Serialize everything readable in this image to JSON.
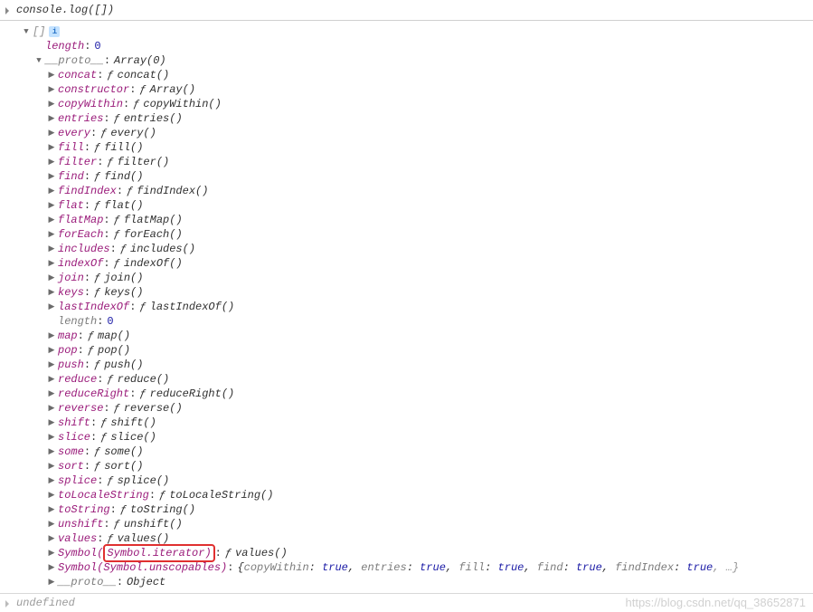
{
  "top": {
    "code": "console.log([])"
  },
  "root": {
    "tag_open": "[]",
    "info_glyph": "i",
    "length_key": "length",
    "length_val": "0",
    "proto_key": "__proto__",
    "proto_val": "Array(0)",
    "methods": [
      {
        "k": "concat",
        "v": "concat()"
      },
      {
        "k": "constructor",
        "v": "Array()"
      },
      {
        "k": "copyWithin",
        "v": "copyWithin()"
      },
      {
        "k": "entries",
        "v": "entries()"
      },
      {
        "k": "every",
        "v": "every()"
      },
      {
        "k": "fill",
        "v": "fill()"
      },
      {
        "k": "filter",
        "v": "filter()"
      },
      {
        "k": "find",
        "v": "find()"
      },
      {
        "k": "findIndex",
        "v": "findIndex()"
      },
      {
        "k": "flat",
        "v": "flat()"
      },
      {
        "k": "flatMap",
        "v": "flatMap()"
      },
      {
        "k": "forEach",
        "v": "forEach()"
      },
      {
        "k": "includes",
        "v": "includes()"
      },
      {
        "k": "indexOf",
        "v": "indexOf()"
      },
      {
        "k": "join",
        "v": "join()"
      },
      {
        "k": "keys",
        "v": "keys()"
      },
      {
        "k": "lastIndexOf",
        "v": "lastIndexOf()"
      }
    ],
    "length2_key": "length",
    "length2_val": "0",
    "methods2": [
      {
        "k": "map",
        "v": "map()"
      },
      {
        "k": "pop",
        "v": "pop()"
      },
      {
        "k": "push",
        "v": "push()"
      },
      {
        "k": "reduce",
        "v": "reduce()"
      },
      {
        "k": "reduceRight",
        "v": "reduceRight()"
      },
      {
        "k": "reverse",
        "v": "reverse()"
      },
      {
        "k": "shift",
        "v": "shift()"
      },
      {
        "k": "slice",
        "v": "slice()"
      },
      {
        "k": "some",
        "v": "some()"
      },
      {
        "k": "sort",
        "v": "sort()"
      },
      {
        "k": "splice",
        "v": "splice()"
      },
      {
        "k": "toLocaleString",
        "v": "toLocaleString()"
      },
      {
        "k": "toString",
        "v": "toString()"
      },
      {
        "k": "unshift",
        "v": "unshift()"
      },
      {
        "k": "values",
        "v": "values()"
      }
    ],
    "symbol_iterator": {
      "prefix": "Symbol(",
      "highlight": "Symbol.iterator)",
      "sep": ": ",
      "val": "values()"
    },
    "symbol_unscopables": {
      "key": "Symbol(Symbol.unscopables)",
      "preview": {
        "items": [
          {
            "k": "copyWithin",
            "v": "true"
          },
          {
            "k": "entries",
            "v": "true"
          },
          {
            "k": "fill",
            "v": "true"
          },
          {
            "k": "find",
            "v": "true"
          },
          {
            "k": "findIndex",
            "v": "true"
          }
        ],
        "trail": ", …}"
      }
    },
    "proto2_key": "__proto__",
    "proto2_val": "Object"
  },
  "bottom": {
    "text": "undefined"
  },
  "watermark": "https://blog.csdn.net/qq_38652871"
}
